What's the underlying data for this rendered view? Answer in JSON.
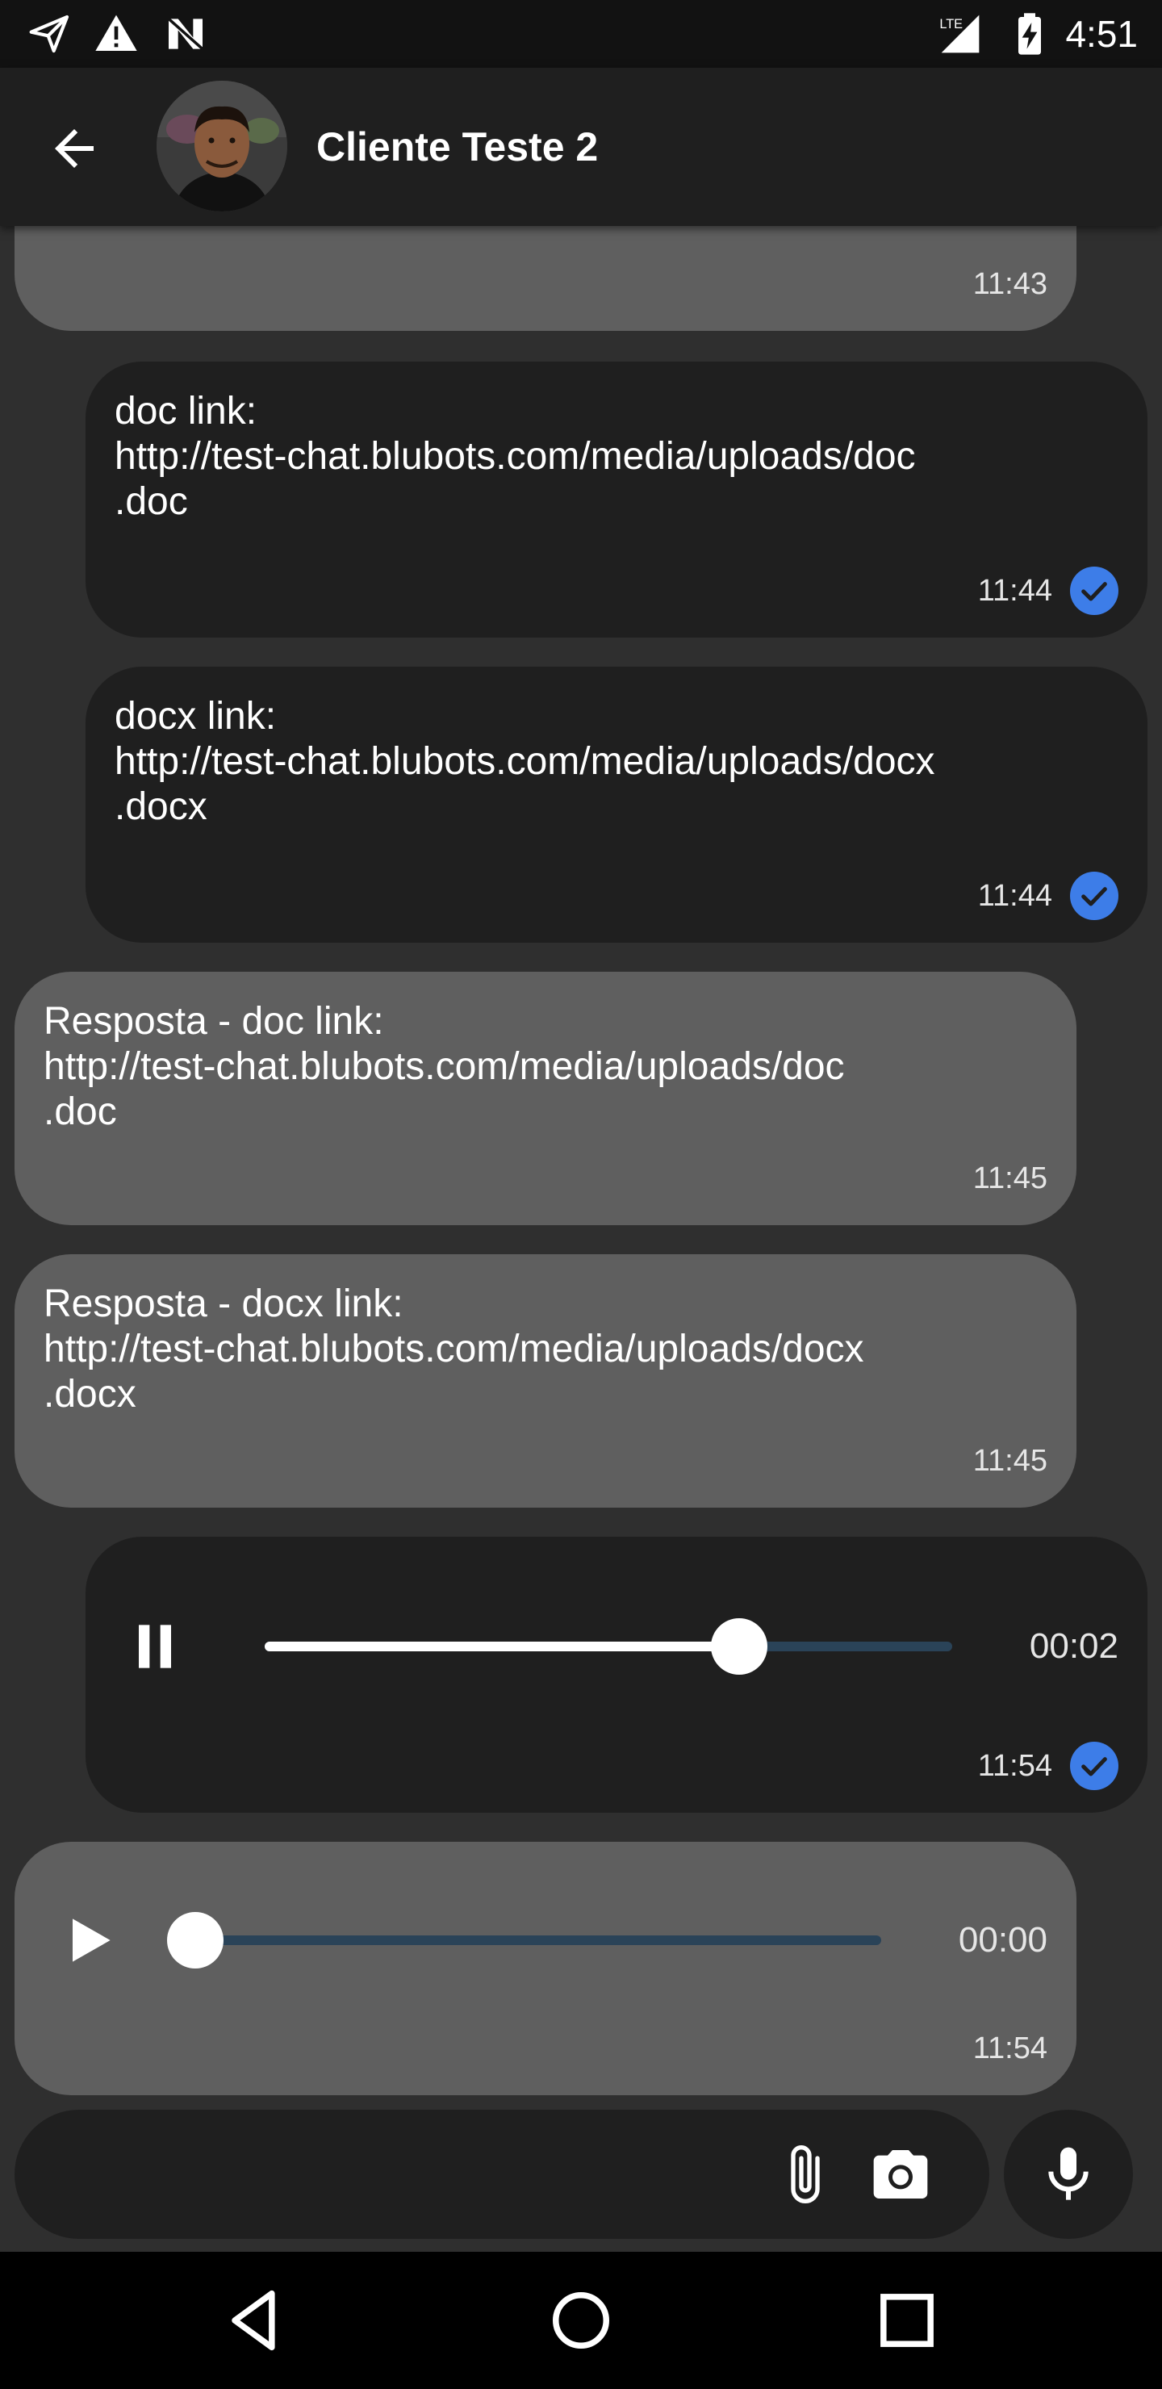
{
  "status_bar": {
    "time": "4:51",
    "network": "LTE",
    "icons": [
      "send-icon",
      "warning-icon",
      "n-icon",
      "signal-icon",
      "battery-charging-icon"
    ]
  },
  "header": {
    "title": "Cliente Teste 2"
  },
  "messages": [
    {
      "direction": "in",
      "text": "",
      "time": "11:43"
    },
    {
      "direction": "out",
      "text": "doc link:\nhttp://test-chat.blubots.com/media/uploads/doc\n.doc",
      "time": "11:44",
      "read": true
    },
    {
      "direction": "out",
      "text": "docx link:\nhttp://test-chat.blubots.com/media/uploads/docx\n.docx",
      "time": "11:44",
      "read": true
    },
    {
      "direction": "in",
      "text": "Resposta - doc link:\nhttp://test-chat.blubots.com/media/uploads/doc\n.doc",
      "time": "11:45"
    },
    {
      "direction": "in",
      "text": "Resposta - docx link:\nhttp://test-chat.blubots.com/media/uploads/docx\n.docx",
      "time": "11:45"
    },
    {
      "direction": "out",
      "type": "audio",
      "state": "playing",
      "progress": 0.69,
      "duration": "00:02",
      "time": "11:54",
      "read": true
    },
    {
      "direction": "in",
      "type": "audio",
      "state": "paused",
      "progress": 0.0,
      "duration": "00:00",
      "time": "11:54"
    }
  ],
  "composer": {
    "placeholder": ""
  },
  "colors": {
    "background": "#2f2f2f",
    "outgoing_bubble": "#1f1f1f",
    "incoming_bubble": "#5f5f5f",
    "read_check": "#3d7de8",
    "audio_track": "#2a4358"
  }
}
